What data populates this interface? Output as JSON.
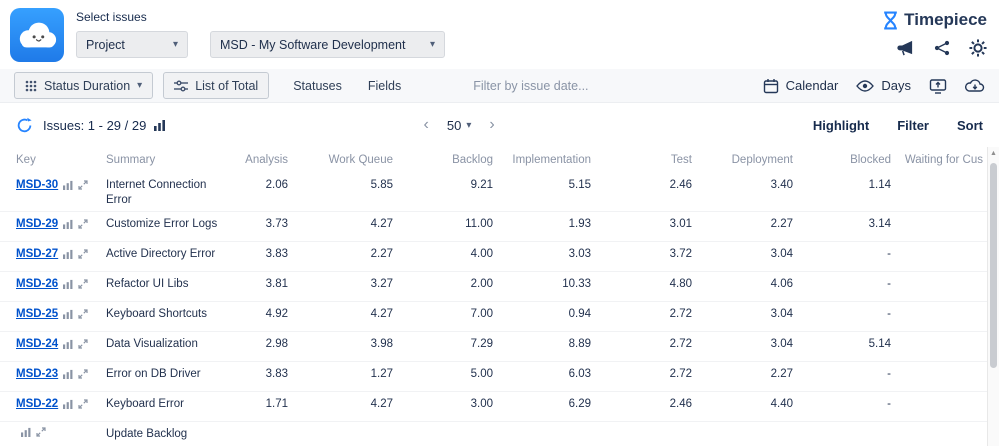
{
  "header": {
    "select_issues_label": "Select issues",
    "scope_select_value": "Project",
    "project_select_value": "MSD - My Software Development",
    "brand_name": "Timepiece"
  },
  "toolbar": {
    "status_duration_label": "Status Duration",
    "list_of_total_label": "List of Total",
    "statuses_label": "Statuses",
    "fields_label": "Fields",
    "date_filter_placeholder": "Filter by issue date...",
    "calendar_label": "Calendar",
    "days_label": "Days"
  },
  "issues_bar": {
    "count_text": "Issues: 1 - 29 / 29",
    "prev_glyph": "‹",
    "next_glyph": "›",
    "page_size": "50",
    "highlight_label": "Highlight",
    "filter_label": "Filter",
    "sort_label": "Sort"
  },
  "table": {
    "columns": [
      {
        "label": "Key",
        "align": "left"
      },
      {
        "label": "Summary",
        "align": "left"
      },
      {
        "label": "Analysis",
        "align": "right"
      },
      {
        "label": "Work Queue",
        "align": "right"
      },
      {
        "label": "Backlog",
        "align": "right"
      },
      {
        "label": "Implementation",
        "align": "right"
      },
      {
        "label": "Test",
        "align": "right"
      },
      {
        "label": "Deployment",
        "align": "right"
      },
      {
        "label": "Blocked",
        "align": "right"
      },
      {
        "label": "Waiting for Cus",
        "align": "right"
      }
    ],
    "rows": [
      {
        "key": "MSD-30",
        "summary": "Internet Connection Error",
        "values": [
          "2.06",
          "5.85",
          "9.21",
          "5.15",
          "2.46",
          "3.40",
          "1.14",
          ""
        ]
      },
      {
        "key": "MSD-29",
        "summary": "Customize Error Logs",
        "values": [
          "3.73",
          "4.27",
          "11.00",
          "1.93",
          "3.01",
          "2.27",
          "3.14",
          ""
        ]
      },
      {
        "key": "MSD-27",
        "summary": "Active Directory Error",
        "values": [
          "3.83",
          "2.27",
          "4.00",
          "3.03",
          "3.72",
          "3.04",
          "-",
          ""
        ]
      },
      {
        "key": "MSD-26",
        "summary": "Refactor UI Libs",
        "values": [
          "3.81",
          "3.27",
          "2.00",
          "10.33",
          "4.80",
          "4.06",
          "-",
          ""
        ]
      },
      {
        "key": "MSD-25",
        "summary": "Keyboard Shortcuts",
        "values": [
          "4.92",
          "4.27",
          "7.00",
          "0.94",
          "2.72",
          "3.04",
          "-",
          ""
        ]
      },
      {
        "key": "MSD-24",
        "summary": "Data Visualization",
        "values": [
          "2.98",
          "3.98",
          "7.29",
          "8.89",
          "2.72",
          "3.04",
          "5.14",
          ""
        ]
      },
      {
        "key": "MSD-23",
        "summary": "Error on DB Driver",
        "values": [
          "3.83",
          "1.27",
          "5.00",
          "6.03",
          "2.72",
          "2.27",
          "-",
          ""
        ]
      },
      {
        "key": "MSD-22",
        "summary": "Keyboard Error",
        "values": [
          "1.71",
          "4.27",
          "3.00",
          "6.29",
          "2.46",
          "4.40",
          "-",
          ""
        ]
      },
      {
        "key": "",
        "summary": "Update Backlog",
        "values": [
          "",
          "",
          "",
          "",
          "",
          "",
          "",
          ""
        ]
      }
    ]
  },
  "icons": {
    "app_logo": "cloud-smiley",
    "brand_logo": "hourglass",
    "header_icons": [
      "megaphone",
      "share",
      "gear"
    ],
    "toolbar_icons": [
      "grid",
      "sliders",
      "calendar",
      "eye",
      "export-screen",
      "cloud-download"
    ],
    "issues_bar_icons": [
      "refresh",
      "bar-chart"
    ],
    "row_icons": [
      "bar-chart",
      "expand"
    ]
  },
  "colors": {
    "accent_blue": "#2684FF",
    "link_blue": "#0052CC",
    "app_icon_blue": "#2F8BFF",
    "text_dark": "#172B4D",
    "muted_gray": "#8A93A5",
    "toolbar_bg": "#F7F8FA"
  }
}
